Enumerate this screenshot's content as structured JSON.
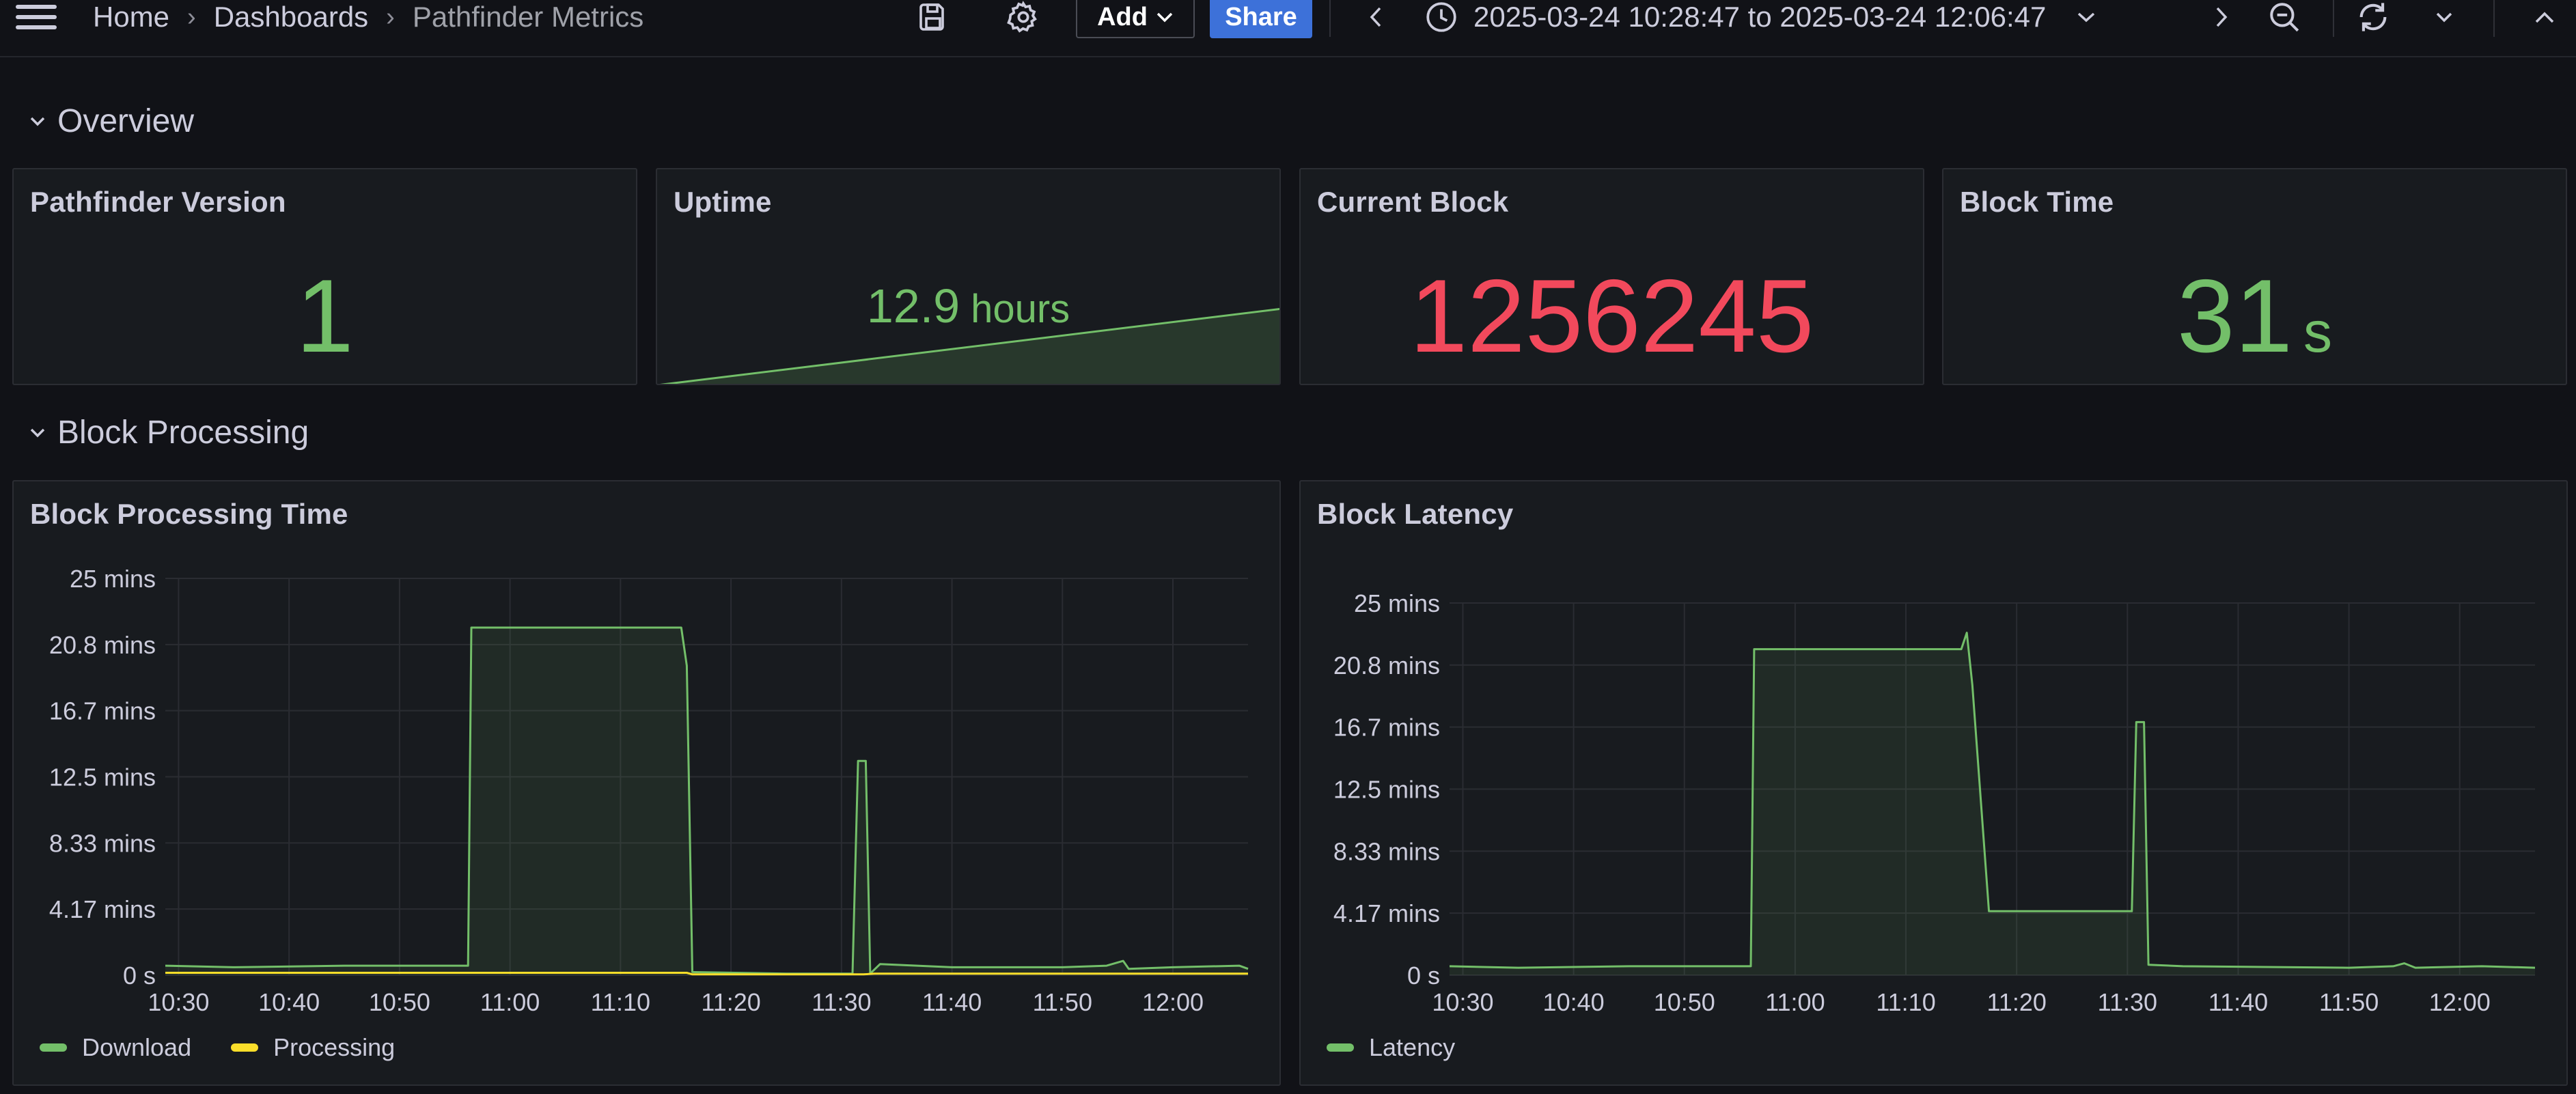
{
  "breadcrumb": {
    "home": "Home",
    "dashboards": "Dashboards",
    "current": "Pathfinder Metrics"
  },
  "toolbar": {
    "add_label": "Add",
    "share_label": "Share",
    "time_range": "2025-03-24 10:28:47 to 2025-03-24 12:06:47"
  },
  "rows": {
    "overview": "Overview",
    "block_processing": "Block Processing"
  },
  "stats": {
    "version": {
      "title": "Pathfinder Version",
      "value": "1",
      "color": "#73bf69"
    },
    "uptime": {
      "title": "Uptime",
      "value": "12.9",
      "unit": "hours",
      "color": "#73bf69"
    },
    "current_block": {
      "title": "Current Block",
      "value": "1256245",
      "color": "#f2495c"
    },
    "block_time": {
      "title": "Block Time",
      "value": "31",
      "unit": "s",
      "color": "#73bf69"
    }
  },
  "colors": {
    "green": "#73bf69",
    "yellow": "#fade2a",
    "red": "#f2495c",
    "share_blue": "#3d71d9"
  },
  "chart_data": [
    {
      "type": "line",
      "title": "Block Processing Time",
      "y_ticks": [
        "25 mins",
        "20.8 mins",
        "16.7 mins",
        "12.5 mins",
        "8.33 mins",
        "4.17 mins",
        "0 s"
      ],
      "x_ticks": [
        "10:30",
        "10:40",
        "10:50",
        "11:00",
        "11:10",
        "11:20",
        "11:30",
        "11:40",
        "11:50",
        "12:00"
      ],
      "ylim_minutes": [
        0,
        25
      ],
      "xlim_minutes_after_10": [
        28.8,
        126.8
      ],
      "legend": "bottom-left",
      "grid": true,
      "series": [
        {
          "name": "Download",
          "color": "#73bf69",
          "fill": true,
          "points": [
            [
              28.8,
              0.6
            ],
            [
              35,
              0.5
            ],
            [
              45,
              0.6
            ],
            [
              55,
              0.6
            ],
            [
              56.2,
              0.6
            ],
            [
              56.5,
              21.9
            ],
            [
              75.5,
              21.9
            ],
            [
              76,
              19.5
            ],
            [
              76.5,
              0.2
            ],
            [
              85,
              0.1
            ],
            [
              90,
              0.1
            ],
            [
              91,
              0.1
            ],
            [
              91.5,
              13.5
            ],
            [
              92.2,
              13.5
            ],
            [
              92.6,
              0.1
            ],
            [
              93.5,
              0.7
            ],
            [
              100,
              0.5
            ],
            [
              110,
              0.5
            ],
            [
              114,
              0.6
            ],
            [
              115.5,
              0.9
            ],
            [
              116,
              0.4
            ],
            [
              120,
              0.5
            ],
            [
              126,
              0.6
            ],
            [
              126.8,
              0.4
            ]
          ]
        },
        {
          "name": "Processing",
          "color": "#fade2a",
          "fill": false,
          "points": [
            [
              28.8,
              0.15
            ],
            [
              50,
              0.15
            ],
            [
              76,
              0.15
            ],
            [
              76.5,
              0.05
            ],
            [
              92,
              0.05
            ],
            [
              93,
              0.1
            ],
            [
              126.8,
              0.1
            ]
          ]
        }
      ]
    },
    {
      "type": "line",
      "title": "Block Latency",
      "y_ticks": [
        "25 mins",
        "20.8 mins",
        "16.7 mins",
        "12.5 mins",
        "8.33 mins",
        "4.17 mins",
        "0 s"
      ],
      "x_ticks": [
        "10:30",
        "10:40",
        "10:50",
        "11:00",
        "11:10",
        "11:20",
        "11:30",
        "11:40",
        "11:50",
        "12:00"
      ],
      "ylim_minutes": [
        0,
        25
      ],
      "xlim_minutes_after_10": [
        28.8,
        126.8
      ],
      "legend": "bottom-left",
      "grid": true,
      "series": [
        {
          "name": "Latency",
          "color": "#73bf69",
          "fill": true,
          "points": [
            [
              28.8,
              0.6
            ],
            [
              35,
              0.5
            ],
            [
              45,
              0.6
            ],
            [
              56,
              0.6
            ],
            [
              56.3,
              21.9
            ],
            [
              75,
              21.9
            ],
            [
              75.5,
              23
            ],
            [
              76,
              19.5
            ],
            [
              77.5,
              4.3
            ],
            [
              90,
              4.3
            ],
            [
              90.4,
              4.3
            ],
            [
              90.8,
              17
            ],
            [
              91.5,
              17
            ],
            [
              91.9,
              0.7
            ],
            [
              95,
              0.6
            ],
            [
              110,
              0.5
            ],
            [
              114,
              0.6
            ],
            [
              115,
              0.8
            ],
            [
              116,
              0.5
            ],
            [
              122,
              0.6
            ],
            [
              126.8,
              0.5
            ]
          ]
        }
      ]
    }
  ]
}
